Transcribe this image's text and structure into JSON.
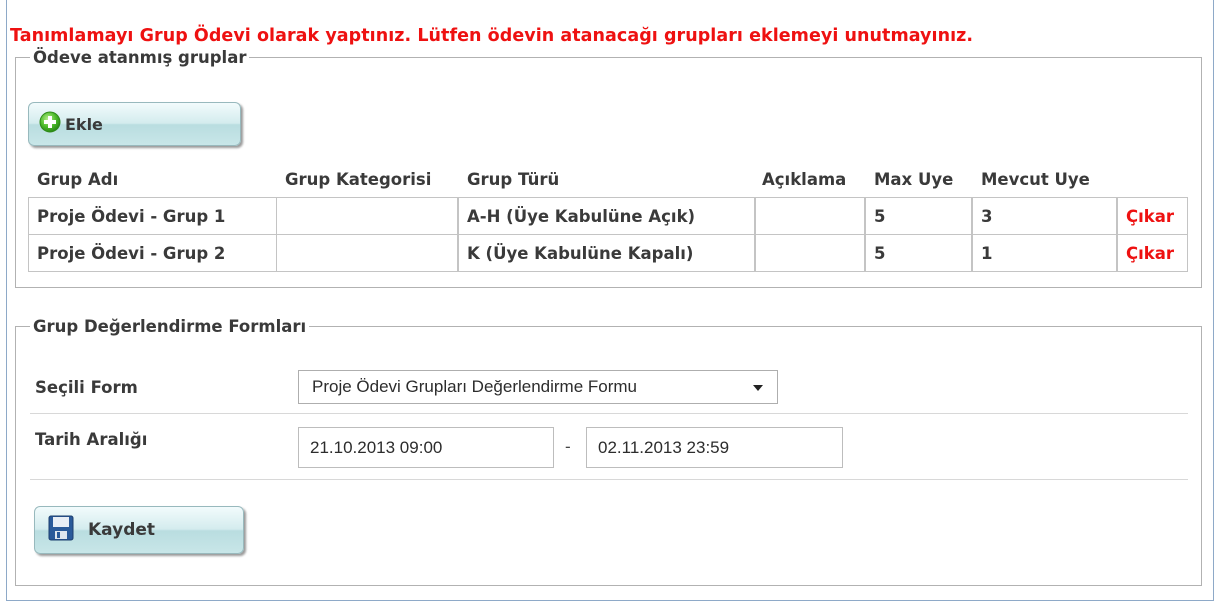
{
  "warning_message": "Tanımlamayı Grup Ödevi olarak yaptınız. Lütfen ödevin atanacağı grupları eklemeyi unutmayınız.",
  "assigned_groups": {
    "legend": "Ödeve atanmış gruplar",
    "add_button_label": "Ekle",
    "add_icon": "plus-circle-icon",
    "columns": [
      "Grup Adı",
      "Grup Kategorisi",
      "Grup Türü",
      "Açıklama",
      "Max Uye",
      "Mevcut Uye"
    ],
    "rows": [
      {
        "name": "Proje Ödevi - Grup 1",
        "category": "",
        "type": "A-H (Üye Kabulüne Açık)",
        "description": "",
        "max": "5",
        "current": "3",
        "action": "Çıkar"
      },
      {
        "name": "Proje Ödevi - Grup 2",
        "category": "",
        "type": "K (Üye Kabulüne Kapalı)",
        "description": "",
        "max": "5",
        "current": "1",
        "action": "Çıkar"
      }
    ]
  },
  "evaluation": {
    "legend": "Grup Değerlendirme Formları",
    "selected_form_label": "Seçili Form",
    "selected_form_value": "Proje Ödevi Grupları Değerlendirme Formu",
    "date_range_label": "Tarih Aralığı",
    "date_start": "21.10.2013 09:00",
    "date_separator": "-",
    "date_end": "02.11.2013 23:59",
    "save_button_label": "Kaydet",
    "save_icon": "floppy-disk-icon"
  },
  "colors": {
    "warning": "#ee1111",
    "remove_link": "#ee1111",
    "text": "#3a3a3a",
    "add_icon": "#33aa22",
    "save_icon": "#2a5a9a"
  }
}
